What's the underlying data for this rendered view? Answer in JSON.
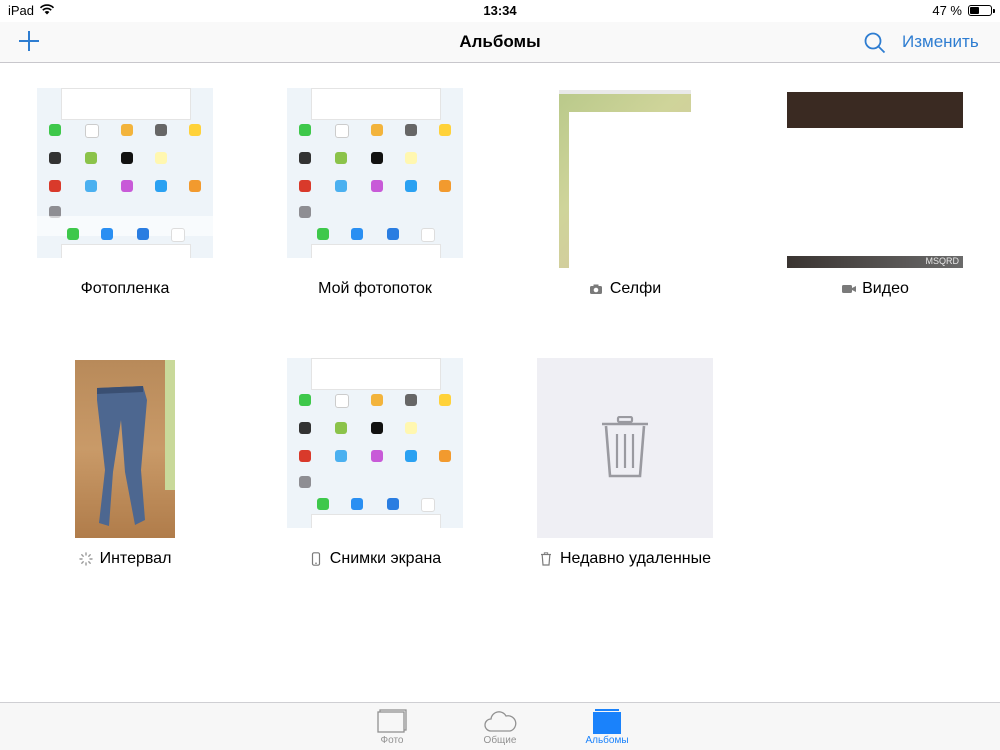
{
  "status_bar": {
    "device": "iPad",
    "time": "13:34",
    "battery": "47 %",
    "battery_level": 0.47
  },
  "nav": {
    "title": "Альбомы",
    "edit_label": "Изменить",
    "add_icon": "plus-icon",
    "search_icon": "search-icon"
  },
  "albums": [
    {
      "name": "Фотопленка",
      "icon": ""
    },
    {
      "name": "Мой фотопоток",
      "icon": ""
    },
    {
      "name": "Селфи",
      "icon": "camera-icon"
    },
    {
      "name": "Видео",
      "icon": "video-camera-icon"
    },
    {
      "name": "Интервал",
      "icon": "timelapse-icon"
    },
    {
      "name": "Снимки экрана",
      "icon": "phone-icon"
    },
    {
      "name": "Недавно удаленные",
      "icon": "trash-icon"
    }
  ],
  "video_watermark": "MSQRD",
  "tabs": [
    {
      "label": "Фото",
      "icon": "photos-icon",
      "active": false
    },
    {
      "label": "Общие",
      "icon": "cloud-icon",
      "active": false
    },
    {
      "label": "Альбомы",
      "icon": "albums-icon",
      "active": true
    }
  ],
  "colors": {
    "accent": "#2e7dd1",
    "tab_active": "#1a82fb",
    "tab_inactive": "#929292"
  }
}
